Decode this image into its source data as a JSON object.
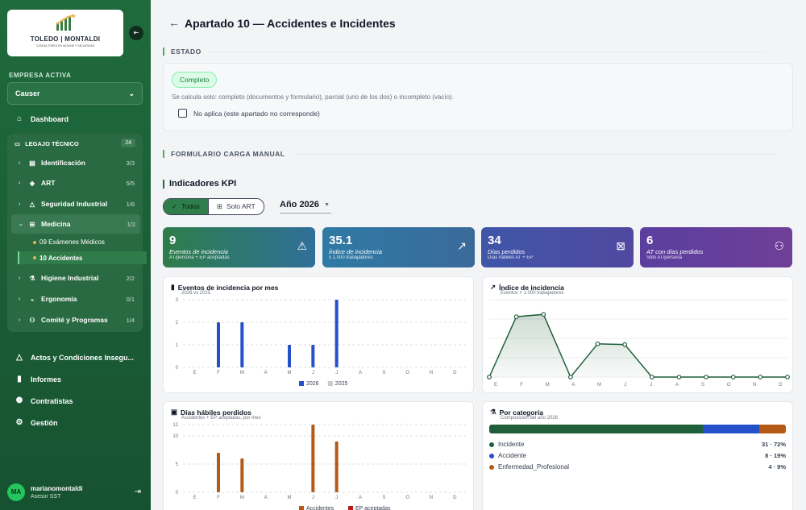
{
  "brand": {
    "logo_name": "TOLEDO | MONTALDI",
    "logo_sub": "CONSULTORES EN HIGIENE Y SEGURIDAD"
  },
  "sidebar": {
    "empresa_label": "EMPRESA ACTIVA",
    "empresa_value": "Causer",
    "dashboard": "Dashboard",
    "legajo": {
      "label": "LEGAJO TÉCNICO",
      "count": "24"
    },
    "sections": [
      {
        "label": "Identificación",
        "count": "3/3",
        "icon": "id-icon"
      },
      {
        "label": "ART",
        "count": "5/5",
        "icon": "shield-icon"
      },
      {
        "label": "Seguridad Industrial",
        "count": "1/6",
        "icon": "warning-icon"
      },
      {
        "label": "Medicina",
        "count": "1/2",
        "icon": "medical-icon"
      },
      {
        "label": "Higiene Industrial",
        "count": "2/2",
        "icon": "flask-icon"
      },
      {
        "label": "Ergonomía",
        "count": "0/1",
        "icon": "chair-icon"
      },
      {
        "label": "Comité y Programas",
        "count": "1/4",
        "icon": "users-icon"
      }
    ],
    "medicina_items": [
      "09 Exámenes Médicos",
      "10 Accidentes"
    ],
    "bottom": [
      "Actos y Condiciones Insegu...",
      "Informes",
      "Contratistas",
      "Gestión"
    ],
    "user": {
      "initials": "MA",
      "name": "marianomontaldi",
      "role": "Asesor SST"
    }
  },
  "header": {
    "title": "Apartado 10 — Accidentes e Incidentes"
  },
  "estado": {
    "section_title": "ESTADO",
    "badge": "Completo",
    "help": "Se calcula solo: completo (documentos y formulario), parcial (uno de los dos) o incompleto (vacío).",
    "no_aplica": "No aplica (este apartado no corresponde)"
  },
  "formulario": {
    "section_title": "FORMULARIO CARGA MANUAL"
  },
  "kpi": {
    "title": "Indicadores KPI",
    "filter_all": "Todos",
    "filter_art": "Solo ART",
    "year": "Año 2026",
    "cards": [
      {
        "value": "9",
        "label": "Eventos de incidencia",
        "sub": "AT/persona + EP aceptadas",
        "color": "#2e7d4a"
      },
      {
        "value": "35.1",
        "label": "Índice de incidencia",
        "sub": "x 1.000 trabajadores",
        "color": "#2f6f99"
      },
      {
        "value": "34",
        "label": "Días perdidos",
        "sub": "Días hábiles AT + EP",
        "color": "#4a4fa5"
      },
      {
        "value": "6",
        "label": "AT con días perdidos",
        "sub": "Solo AT/persona",
        "color": "#6a3f9a"
      }
    ]
  },
  "charts": {
    "eventos": {
      "title": "Eventos de incidencia por mes",
      "subtitle": "2026 vs 2025",
      "legend": [
        "2026",
        "2025"
      ]
    },
    "indice": {
      "title": "Índice de incidencia",
      "subtitle": "Eventos × 1.000 trabajadores"
    },
    "dias": {
      "title": "Días hábiles perdidos",
      "subtitle": "Accidentes + EP aceptadas, por mes",
      "legend": [
        "Accidentes",
        "EP aceptadas"
      ]
    },
    "categoria": {
      "title": "Por categoría",
      "subtitle": "Composición del año 2026",
      "rows": [
        {
          "label": "Incidente",
          "value": "31 · 72%",
          "color": "#1f5f3a"
        },
        {
          "label": "Accidente",
          "value": "8 · 19%",
          "color": "#2451c9"
        },
        {
          "label": "Enfermedad_Profesional",
          "value": "4 · 9%",
          "color": "#b55a14"
        }
      ]
    }
  },
  "chart_data": [
    {
      "type": "bar",
      "title": "Eventos de incidencia por mes",
      "subtitle": "2026 vs 2025",
      "categories": [
        "E",
        "F",
        "M",
        "A",
        "M",
        "J",
        "J",
        "A",
        "S",
        "O",
        "N",
        "D"
      ],
      "series": [
        {
          "name": "2026",
          "values": [
            0,
            2,
            2,
            0,
            1,
            1,
            3,
            0,
            0,
            0,
            0,
            0
          ],
          "color": "#2451c9"
        },
        {
          "name": "2025",
          "values": [
            0,
            0,
            0,
            0,
            0,
            0,
            0,
            0,
            0,
            0,
            0,
            0
          ],
          "color": "#c7cbd3"
        }
      ],
      "yticks": [
        0,
        1,
        2,
        3
      ],
      "ylim": [
        0,
        3
      ],
      "grid": true,
      "legend": "bottom"
    },
    {
      "type": "area",
      "title": "Índice de incidencia",
      "subtitle": "Eventos × 1.000 trabajadores",
      "categories": [
        "E",
        "F",
        "M",
        "A",
        "M",
        "J",
        "J",
        "A",
        "S",
        "O",
        "N",
        "D"
      ],
      "series": [
        {
          "values": [
            0,
            7.8,
            8.1,
            0,
            4.3,
            4.2,
            0,
            0,
            0,
            0,
            0,
            0
          ],
          "color": "#1f5f3a"
        }
      ],
      "ylim": [
        0,
        10
      ],
      "grid": true
    },
    {
      "type": "bar",
      "title": "Días hábiles perdidos",
      "subtitle": "Accidentes + EP aceptadas, por mes",
      "categories": [
        "E",
        "F",
        "M",
        "A",
        "M",
        "J",
        "J",
        "A",
        "S",
        "O",
        "N",
        "D"
      ],
      "series": [
        {
          "name": "Accidentes",
          "values": [
            0,
            7,
            6,
            0,
            0,
            12,
            9,
            0,
            0,
            0,
            0,
            0
          ],
          "color": "#b55a14"
        },
        {
          "name": "EP aceptadas",
          "values": [
            0,
            0,
            0,
            0,
            0,
            0,
            0,
            0,
            0,
            0,
            0,
            0
          ],
          "color": "#b91c1c"
        }
      ],
      "yticks": [
        0,
        5,
        10,
        12
      ],
      "ylim": [
        0,
        12
      ],
      "grid": true,
      "legend": "bottom"
    }
  ]
}
